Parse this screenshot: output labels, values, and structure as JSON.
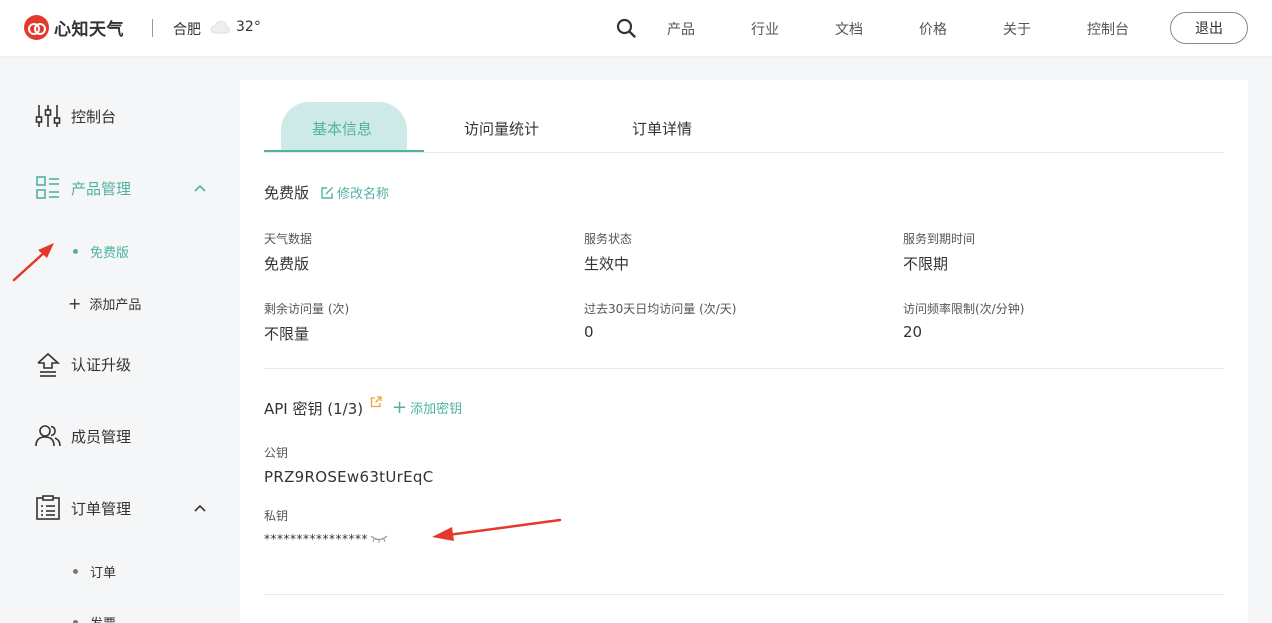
{
  "header": {
    "logo_text": "心知天气",
    "city": "合肥",
    "temperature": "32°",
    "nav": [
      "产品",
      "行业",
      "文档",
      "价格",
      "关于",
      "控制台"
    ],
    "logout_label": "退出"
  },
  "sidebar": {
    "items": [
      {
        "label": "控制台",
        "icon": "sliders-icon"
      },
      {
        "label": "产品管理",
        "icon": "product-grid-icon",
        "expanded": true
      },
      {
        "label": "认证升级",
        "icon": "upgrade-icon"
      },
      {
        "label": "成员管理",
        "icon": "members-icon"
      },
      {
        "label": "订单管理",
        "icon": "order-list-icon",
        "expanded": true
      }
    ],
    "product_sub": [
      {
        "label": "免费版",
        "active": true
      },
      {
        "label": "添加产品"
      }
    ],
    "order_sub": [
      {
        "label": "订单"
      },
      {
        "label": "发票"
      }
    ]
  },
  "tabs": [
    "基本信息",
    "访问量统计",
    "订单详情"
  ],
  "plan": {
    "name": "免费版",
    "rename_label": "修改名称"
  },
  "fields": [
    {
      "label": "天气数据",
      "value": "免费版"
    },
    {
      "label": "服务状态",
      "value": "生效中"
    },
    {
      "label": "服务到期时间",
      "value": "不限期"
    },
    {
      "label": "剩余访问量 (次)",
      "value": "不限量"
    },
    {
      "label": "过去30天日均访问量 (次/天)",
      "value": "0"
    },
    {
      "label": "访问频率限制(次/分钟)",
      "value": "20"
    }
  ],
  "api": {
    "title": "API 密钥 (1/3)",
    "add_label": "添加密钥",
    "public_key_label": "公钥",
    "public_key": "PRZ9ROSEw63tUrEqC",
    "private_key_label": "私钥",
    "private_key": "****************"
  },
  "colors": {
    "accent": "#4fb3a3",
    "annotation_red": "#e5382d",
    "logo_red": "#e5382d"
  }
}
